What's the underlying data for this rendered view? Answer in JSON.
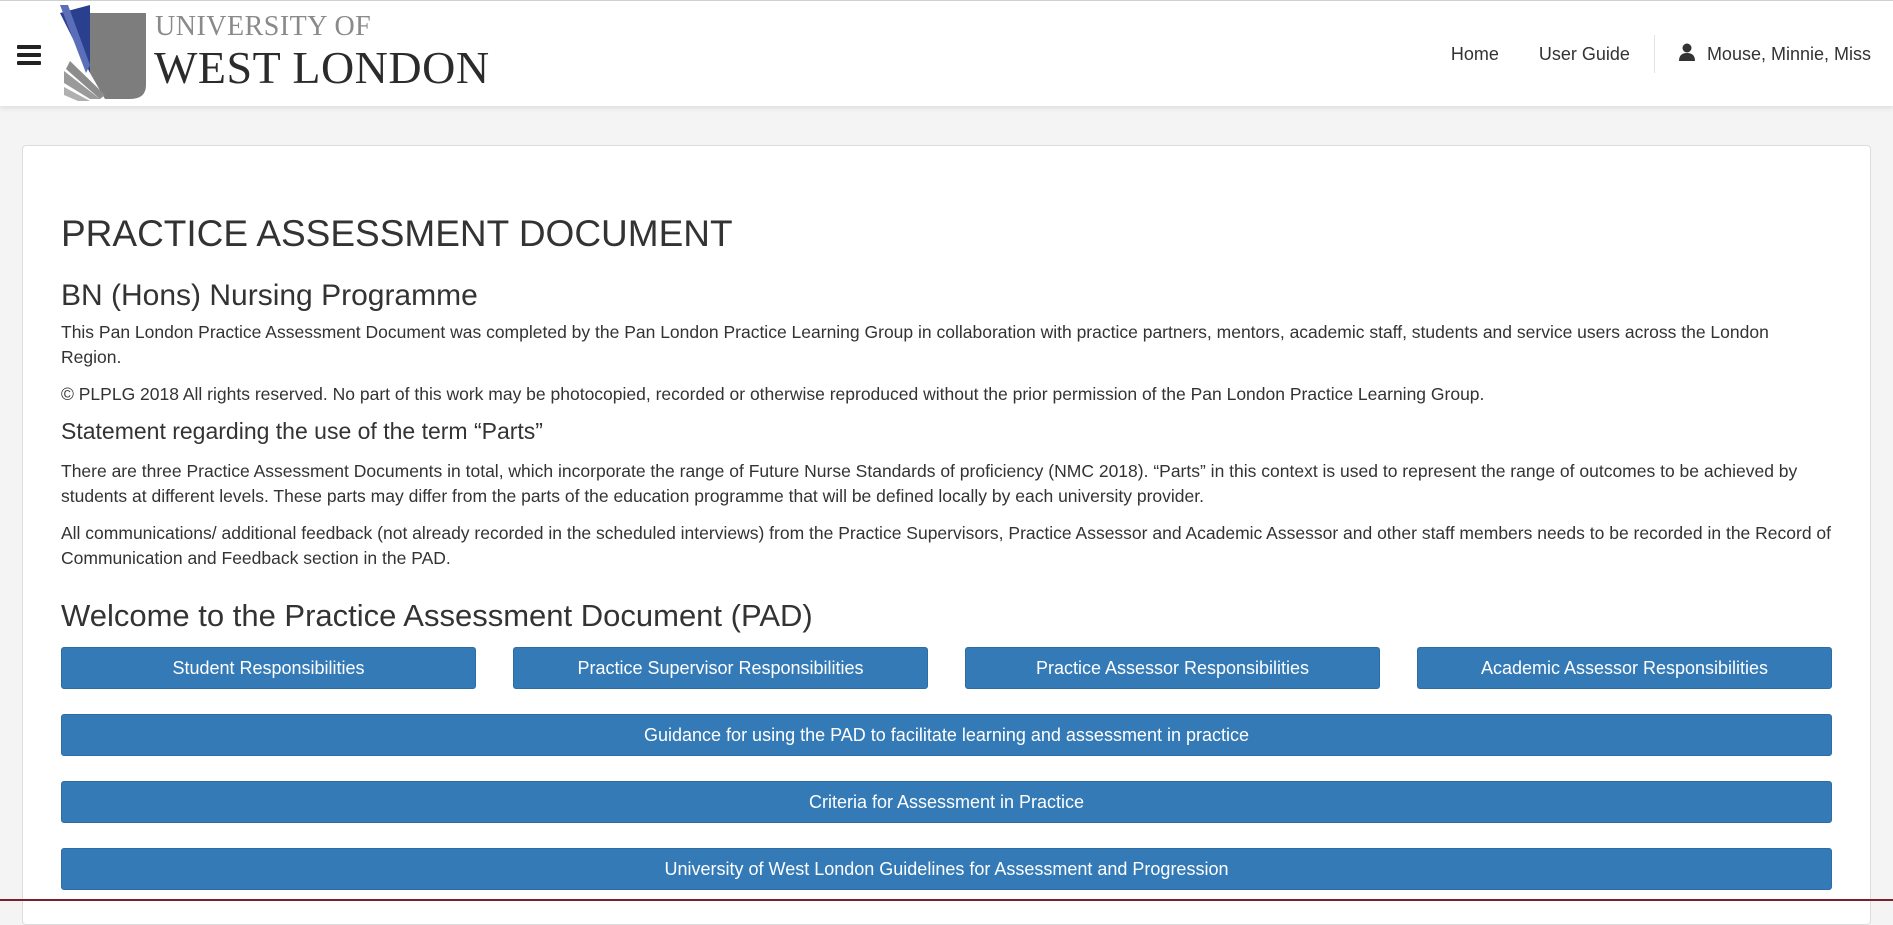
{
  "header": {
    "logo_line1": "UNIVERSITY OF",
    "logo_line2": "WEST LONDON",
    "nav_home": "Home",
    "nav_user_guide": "User Guide",
    "user_name": "Mouse, Minnie, Miss",
    "icons": {
      "menu": "hamburger-menu-icon",
      "user": "user-icon"
    }
  },
  "main": {
    "title": "PRACTICE ASSESSMENT DOCUMENT",
    "programme": "BN (Hons) Nursing Programme",
    "intro": "This Pan London Practice Assessment Document was completed by the Pan London Practice Learning Group in collaboration with practice partners, mentors, academic staff, students and service users across the London Region.",
    "copyright": "© PLPLG 2018 All rights reserved. No part of this work may be photocopied, recorded or otherwise reproduced without the prior permission of the Pan London Practice Learning Group.",
    "statement_heading": "Statement regarding the use of the term “Parts”",
    "statement_text": "There are three Practice Assessment Documents in total, which incorporate the range of Future Nurse Standards of proficiency (NMC 2018). “Parts” in this context is used to represent the range of outcomes to be achieved by students at different levels. These parts may differ from the parts of the education programme that will be defined locally by each university provider.",
    "communications_text": "All communications/ additional feedback (not already recorded in the scheduled interviews) from the Practice Supervisors, Practice Assessor and Academic Assessor and other staff members needs to be recorded in the Record of Communication and Feedback section in the PAD.",
    "welcome_heading": "Welcome to the Practice Assessment Document (PAD)",
    "responsibility_buttons": [
      "Student Responsibilities",
      "Practice Supervisor Responsibilities",
      "Practice Assessor Responsibilities",
      "Academic Assessor Responsibilities"
    ],
    "guidance_button": "Guidance for using the PAD to facilitate learning and assessment in practice",
    "criteria_button": "Criteria for Assessment in Practice",
    "guidelines_button": "University of West London Guidelines for Assessment and Progression"
  },
  "colors": {
    "button_primary": "#337ab7",
    "logo_blue": "#2b3f8f",
    "logo_grey": "#8a8a8a"
  }
}
